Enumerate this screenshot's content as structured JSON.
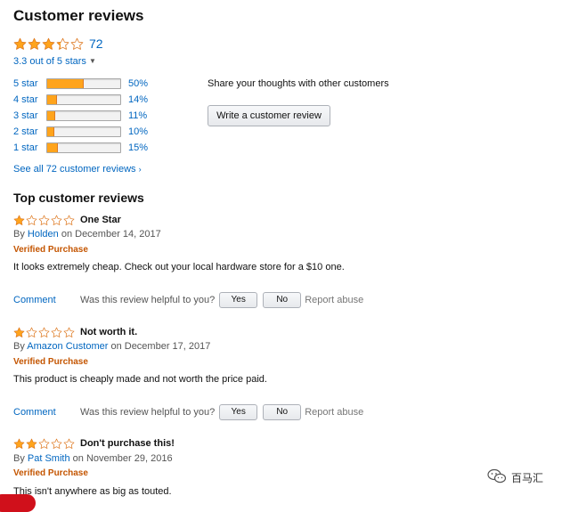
{
  "header": {
    "title": "Customer reviews"
  },
  "summary": {
    "rating": 3.3,
    "rating_text": "3.3 out of 5 stars",
    "review_count": "72",
    "star_icon": "star-icon",
    "caret_icon": "▼"
  },
  "histogram": [
    {
      "label": "5 star",
      "percent_text": "50%",
      "fill_fraction": 0.5
    },
    {
      "label": "4 star",
      "percent_text": "14%",
      "fill_fraction": 0.14
    },
    {
      "label": "3 star",
      "percent_text": "11%",
      "fill_fraction": 0.11
    },
    {
      "label": "2 star",
      "percent_text": "10%",
      "fill_fraction": 0.1
    },
    {
      "label": "1 star",
      "percent_text": "15%",
      "fill_fraction": 0.15
    }
  ],
  "see_all": {
    "label": "See all 72 customer reviews",
    "caret": "›"
  },
  "share": {
    "prompt": "Share your thoughts with other customers",
    "button_label": "Write a customer review"
  },
  "top_reviews": {
    "heading": "Top customer reviews",
    "items": [
      {
        "stars": 1,
        "title": "One Star",
        "by_prefix": "By",
        "author": "Holden",
        "date": "on December 14, 2017",
        "verified": "Verified Purchase",
        "body": "It looks extremely cheap. Check out your local hardware store for a $10 one.",
        "comment_label": "Comment",
        "helpful_question": "Was this review helpful to you?",
        "yes_label": "Yes",
        "no_label": "No",
        "report_label": "Report abuse"
      },
      {
        "stars": 1,
        "title": "Not worth it.",
        "by_prefix": "By",
        "author": "Amazon Customer",
        "date": "on December 17, 2017",
        "verified": "Verified Purchase",
        "body": "This product is cheaply made and not worth the price paid.",
        "comment_label": "Comment",
        "helpful_question": "Was this review helpful to you?",
        "yes_label": "Yes",
        "no_label": "No",
        "report_label": "Report abuse"
      },
      {
        "stars": 2,
        "title": "Don't purchase this!",
        "by_prefix": "By",
        "author": "Pat Smith",
        "date": "on November 29, 2016",
        "verified": "Verified Purchase",
        "body": "This isn't anywhere as big as touted."
      }
    ]
  },
  "watermark": {
    "text": "百马汇",
    "icon": "wechat-icon"
  },
  "colors": {
    "star_fill": "#ffa41c",
    "star_outline": "#de7921",
    "link": "#0066c0",
    "verified": "#c45500",
    "bar_fill": "#ffa41c"
  }
}
